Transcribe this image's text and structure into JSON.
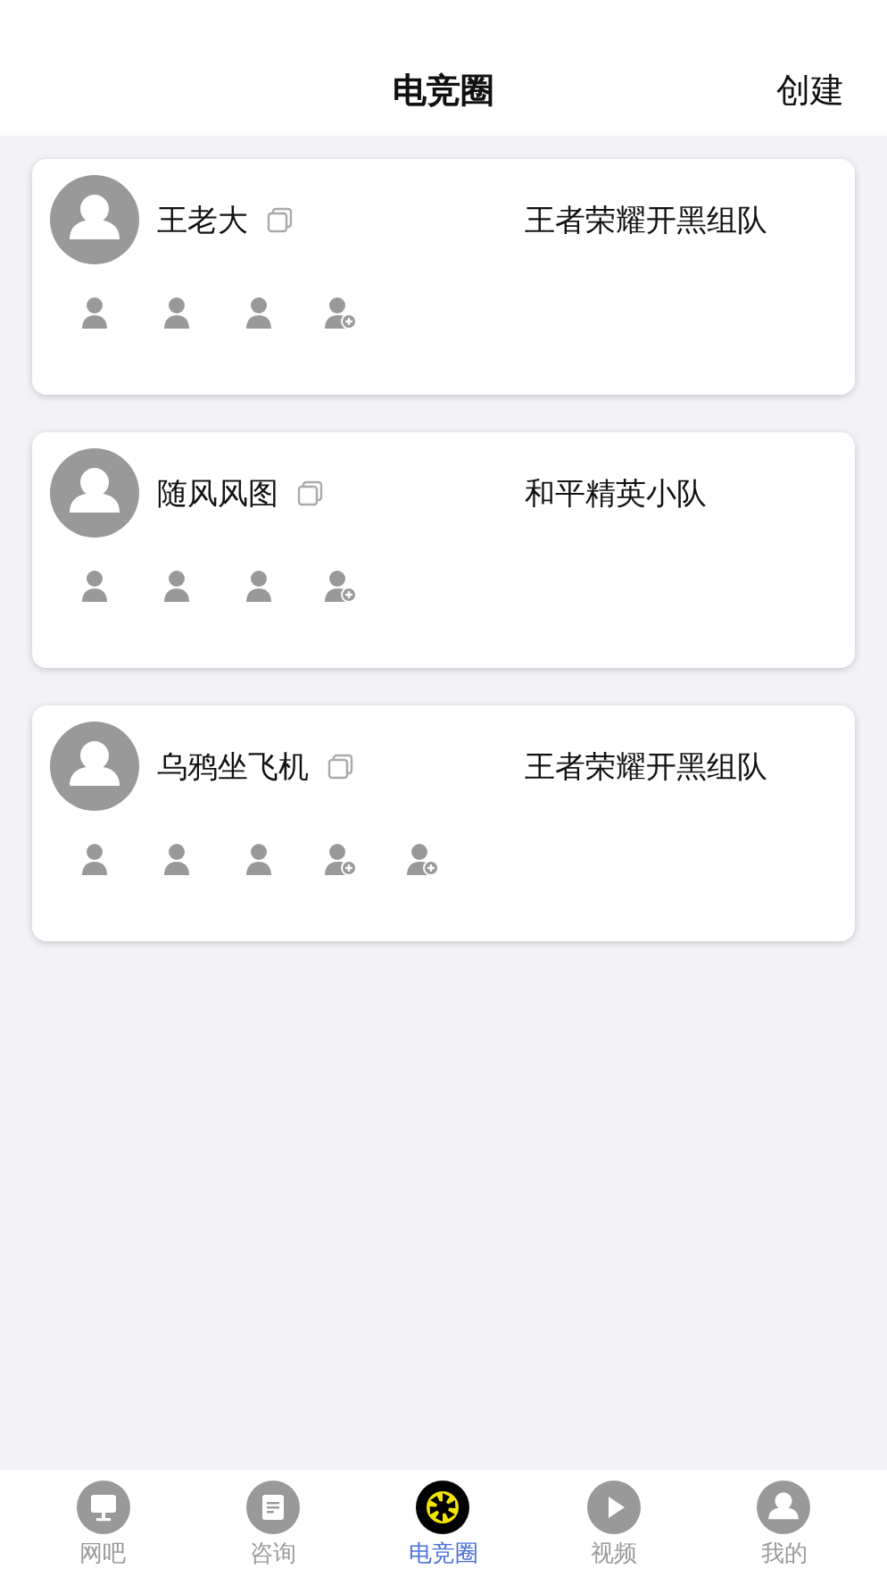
{
  "header": {
    "title": "电竞圈",
    "action": "创建"
  },
  "teams": [
    {
      "leader": "王老大",
      "game": "王者荣耀开黑组队",
      "slots": [
        {
          "kind": "member"
        },
        {
          "kind": "member"
        },
        {
          "kind": "member"
        },
        {
          "kind": "open"
        }
      ]
    },
    {
      "leader": "随风风图",
      "game": "和平精英小队",
      "slots": [
        {
          "kind": "member"
        },
        {
          "kind": "member"
        },
        {
          "kind": "member"
        },
        {
          "kind": "open"
        }
      ]
    },
    {
      "leader": "乌鸦坐飞机",
      "game": "王者荣耀开黑组队",
      "slots": [
        {
          "kind": "member"
        },
        {
          "kind": "member"
        },
        {
          "kind": "member"
        },
        {
          "kind": "open"
        },
        {
          "kind": "open"
        }
      ]
    }
  ],
  "tab_bar": [
    {
      "label": "网吧",
      "kind": "monitor",
      "selected": false
    },
    {
      "label": "咨询",
      "kind": "document",
      "selected": false
    },
    {
      "label": "电竞圈",
      "kind": "aperture",
      "selected": true
    },
    {
      "label": "视频",
      "kind": "play",
      "selected": false
    },
    {
      "label": "我的",
      "kind": "person",
      "selected": false
    }
  ]
}
